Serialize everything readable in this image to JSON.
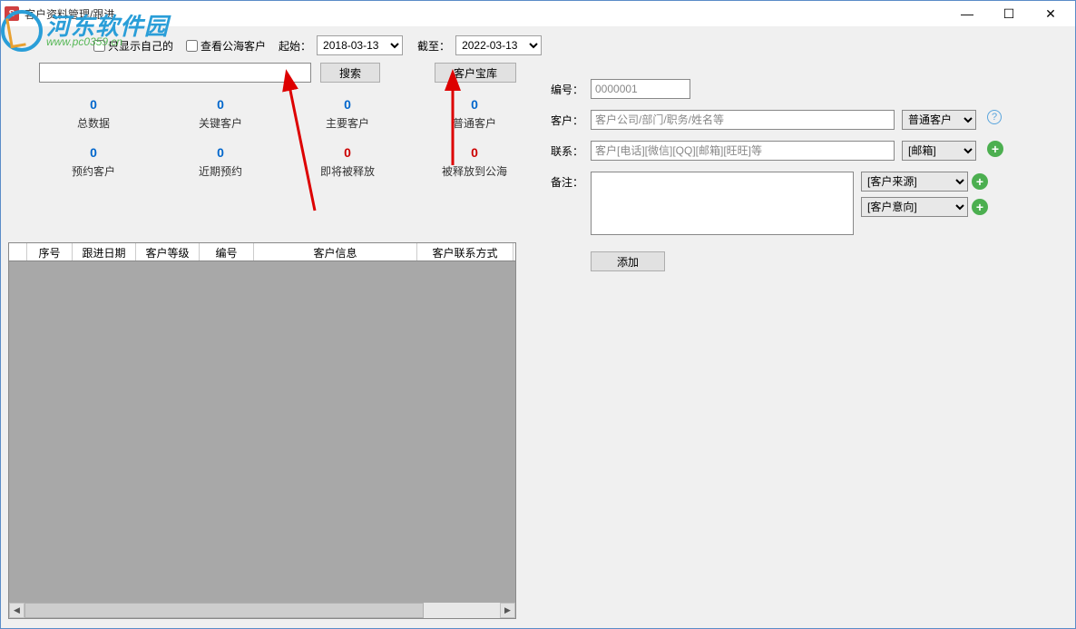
{
  "window": {
    "title": "客户资料管理/跟进"
  },
  "watermark": {
    "text": "河东软件园",
    "url": "www.pc0359.cn"
  },
  "filters": {
    "only_mine_label": "只显示自己的",
    "view_public_label": "查看公海客户",
    "start_label": "起始：",
    "end_label": "截至：",
    "start_date": "2018-03-13",
    "end_date": "2022-03-13"
  },
  "search": {
    "value": "",
    "search_btn": "搜索",
    "treasure_btn": "客户宝库"
  },
  "stats": {
    "row1": [
      {
        "num": "0",
        "color": "blue",
        "label": "总数据"
      },
      {
        "num": "0",
        "color": "blue",
        "label": "关键客户"
      },
      {
        "num": "0",
        "color": "blue",
        "label": "主要客户"
      },
      {
        "num": "0",
        "color": "blue",
        "label": "普通客户"
      }
    ],
    "row2": [
      {
        "num": "0",
        "color": "blue",
        "label": "预约客户"
      },
      {
        "num": "0",
        "color": "blue",
        "label": "近期预约"
      },
      {
        "num": "0",
        "color": "red",
        "label": "即将被释放"
      },
      {
        "num": "0",
        "color": "red",
        "label": "被释放到公海"
      }
    ]
  },
  "table": {
    "columns": [
      "",
      "序号",
      "跟进日期",
      "客户等级",
      "编号",
      "客户信息",
      "客户联系方式"
    ]
  },
  "form": {
    "id_label": "编号：",
    "id_value": "0000001",
    "customer_label": "客户：",
    "customer_placeholder": "客户公司/部门/职务/姓名等",
    "customer_type": "普通客户",
    "contact_label": "联系：",
    "contact_placeholder": "客户[电话][微信][QQ][邮箱][旺旺]等",
    "contact_type": "[邮箱]",
    "remarks_label": "备注：",
    "source_select": "[客户来源]",
    "intent_select": "[客户意向]",
    "add_btn": "添加"
  }
}
